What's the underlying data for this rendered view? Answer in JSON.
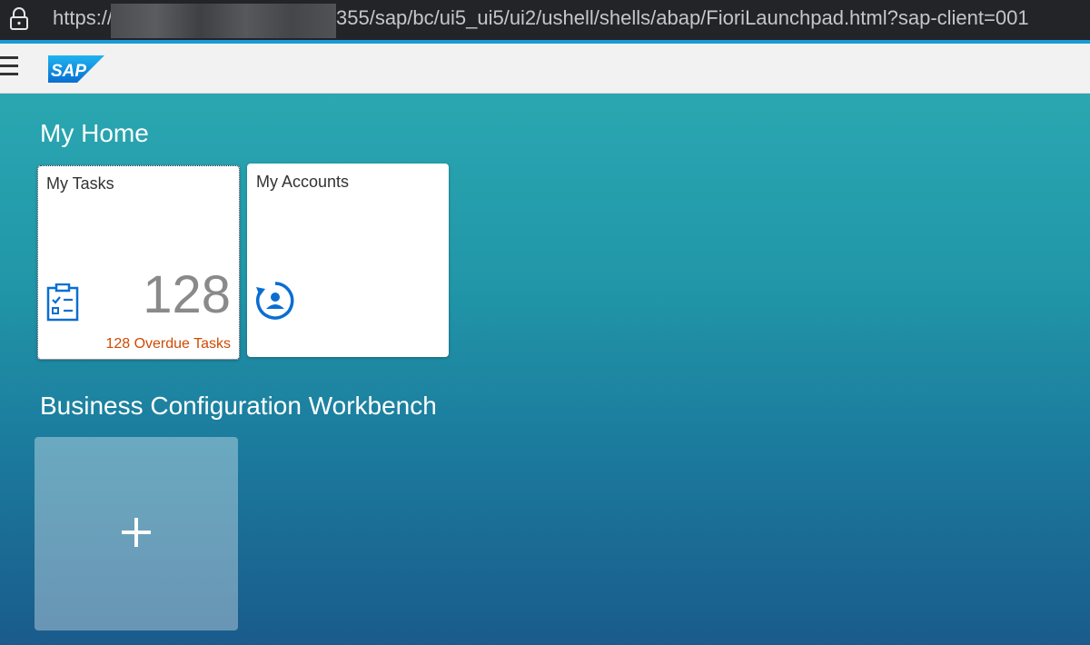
{
  "browser": {
    "url_prefix": "https://",
    "url_suffix": "355/sap/bc/ui5_ui5/ui2/ushell/shells/abap/FioriLaunchpad.html?sap-client=001",
    "lock_icon": "lock-icon"
  },
  "shell": {
    "menu_icon": "hamburger-menu-icon",
    "logo_text": "SAP",
    "logo_color": "#0a6ed1"
  },
  "groups": [
    {
      "title": "My Home",
      "tiles": [
        {
          "title": "My Tasks",
          "number": "128",
          "footer": "128 Overdue Tasks",
          "footer_color": "#d04a02",
          "icon": "task-clipboard-icon"
        },
        {
          "title": "My Accounts",
          "icon": "account-refresh-icon"
        }
      ]
    },
    {
      "title": "Business Configuration Workbench",
      "tiles": [
        {
          "icon": "plus-icon"
        }
      ]
    }
  ],
  "colors": {
    "accent": "#1a9ad6",
    "icon_blue": "#0a6ed1"
  }
}
